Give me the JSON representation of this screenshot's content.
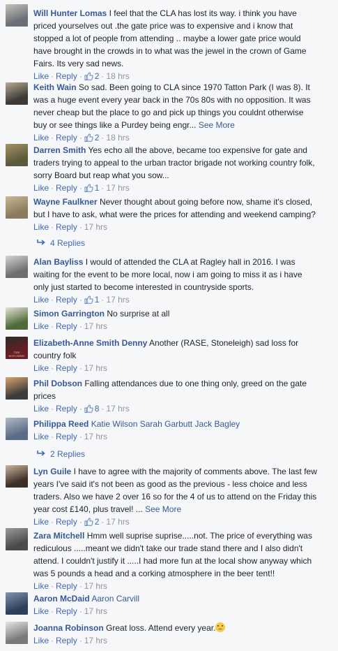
{
  "comments": [
    {
      "name": "Will Hunter Lomas",
      "text": "I feel that the CLA has lost its way. i think you have priced yourselves out .the gate price was to expensive and i know that stopped a lot of people from attending .. maybe a lower gate price would have brought in the crowds in to what was the jewel in the crown of Game Fairs. Its very sad news.",
      "likes": "2",
      "time": "18 hrs",
      "avatar_colors": [
        "#6b6f78",
        "#c7c2b8"
      ]
    },
    {
      "name": "Keith Wain",
      "text": "So sad. Been going to CLA since 1970 Tatton Park (I was 8). It was a huge event every year back in the 70s 80s with no opposition. It was never cheap but the place to go and pick up things you couldnt otherwise buy or see things like a Purdey being engr...",
      "see_more": "See More",
      "likes": "2",
      "time": "18 hrs",
      "avatar_colors": [
        "#3d3a35",
        "#b7aa94"
      ]
    },
    {
      "name": "Darren Smith",
      "text": "Yes echo all the above, became too expensive for gate and traders trying to appeal to the urban tractor brigade not working country folk, sorry Board but reap what you sow...",
      "likes": "1",
      "time": "17 hrs",
      "avatar_colors": [
        "#5a5b3a",
        "#a99168"
      ]
    },
    {
      "name": "Wayne Faulkner",
      "text": "Never thought about going before now, shame it's closed, but I have to ask, what were the prices for attending and weekend camping?",
      "likes": "",
      "time": "17 hrs",
      "avatar_colors": [
        "#8c7a5d",
        "#c9b896"
      ]
    },
    {
      "name": "Alan Bayliss",
      "text": "I would of attended the CLA at Ragley hall in 2016. I was waiting for the event to be more local, now i am going to miss it as i have only just started to become interested in countryside sports.",
      "likes": "1",
      "time": "17 hrs",
      "avatar_colors": [
        "#6e6e6e",
        "#d4d4d4"
      ]
    },
    {
      "name": "Simon Garrington",
      "text": "No surprise at all",
      "likes": "",
      "time": "17 hrs",
      "avatar_colors": [
        "#4f6b3a",
        "#e8e3d8"
      ]
    },
    {
      "name": "Elizabeth-Anne Smith Denny",
      "text": "Another (RASE, Stoneleigh) sad loss for country folk",
      "likes": "",
      "time": "17 hrs",
      "avatar_colors": [
        "#6a1e24",
        "#2b2b2b"
      ],
      "avatar_caption": "THE WITCHERY"
    },
    {
      "name": "Phil Dobson",
      "text": "Falling attendances due to one thing only, greed on the gate prices",
      "likes": "8",
      "time": "17 hrs",
      "avatar_colors": [
        "#3c3c3c",
        "#d9a46b"
      ]
    },
    {
      "name": "Philippa Reed",
      "tags": [
        "Katie Wilson",
        "Sarah Garbutt",
        "Jack Bagley"
      ],
      "text": "",
      "likes": "",
      "time": "17 hrs",
      "avatar_colors": [
        "#5b6d86",
        "#b3b9c4"
      ]
    },
    {
      "name": "Lyn Guile",
      "text": "I have to agree with the majority of comments above. The last few years I've said it's not been as good as the previous - less choice and less traders. Also we have 2 over 16 so for the 4 of us to attend on the Friday this year cost £140, plus travel! ...",
      "see_more": "See More",
      "likes": "2",
      "time": "17 hrs",
      "avatar_colors": [
        "#3b2f27",
        "#c9b59a"
      ]
    },
    {
      "name": "Zara Mitchell",
      "text": "Hmm well suprise suprise.....not. The price of everything was rediculous .....meant we didn't take our trade stand there and I also didn't attend. I couldn't justify it .....I had more fun at the local show anyway which was 5 pounds a head and a corking atmosphere in the beer tent!!",
      "likes": "",
      "time": "17 hrs",
      "avatar_colors": [
        "#4a4a4a",
        "#9b9b9b"
      ]
    },
    {
      "name": "Aaron McDaid",
      "tags": [
        "Aaron Carvill"
      ],
      "text": "",
      "likes": "",
      "time": "17 hrs",
      "avatar_colors": [
        "#2e4057",
        "#7f95b0"
      ]
    },
    {
      "name": "Joanna Robinson",
      "text": "Great loss. Attend every year.",
      "emoji": "crying-face-icon",
      "likes": "",
      "time": "17 hrs",
      "avatar_colors": [
        "#7a7a7a",
        "#e6e6e6"
      ]
    }
  ],
  "replies": [
    {
      "label": "4 Replies",
      "icon": "reply-arrow-icon"
    },
    {
      "label": "2 Replies",
      "icon": "reply-arrow-icon"
    }
  ],
  "actions": {
    "like": "Like",
    "reply": "Reply",
    "separator": "·"
  },
  "colors": {
    "name": "#365899",
    "link": "#4267b2",
    "meta": "#90949c",
    "text": "#1d2129",
    "background": "#f6f7f9"
  }
}
